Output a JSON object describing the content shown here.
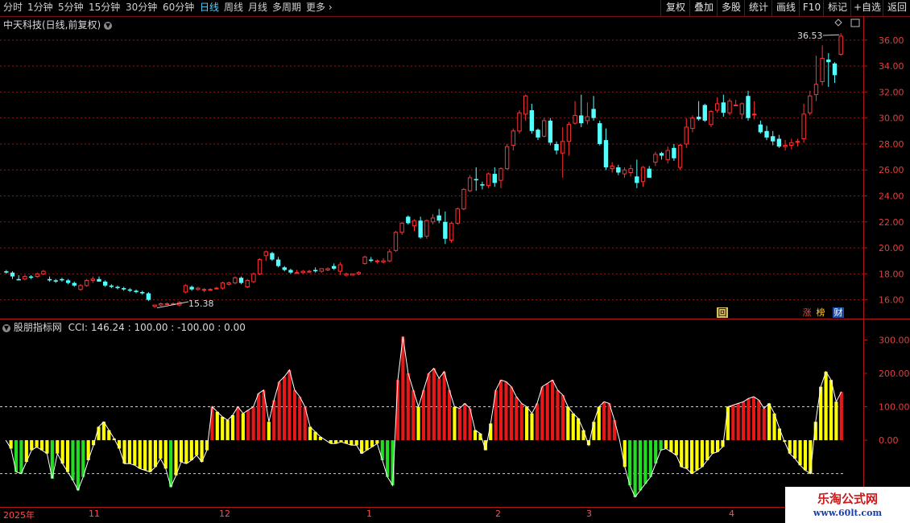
{
  "toolbar": {
    "periods": [
      "分时",
      "1分钟",
      "5分钟",
      "15分钟",
      "30分钟",
      "60分钟",
      "日线",
      "周线",
      "月线",
      "多周期",
      "更多"
    ],
    "active_period": "日线",
    "right_buttons": [
      "复权",
      "叠加",
      "多股",
      "统计",
      "画线",
      "F10",
      "标记",
      "+自选",
      "返回"
    ]
  },
  "price_panel": {
    "title": "中天科技(日线,前复权)",
    "high_label": "36.53",
    "low_label": "15.38",
    "badges": [
      "回",
      "涨",
      "榜",
      "财"
    ]
  },
  "indicator_panel": {
    "title": "股朋指标网",
    "cci_text": "CCI: 146.24 : 100.00 : -100.00 : 0.00"
  },
  "date_axis": [
    "2025年",
    "11",
    "12",
    "1",
    "2",
    "3",
    "4"
  ],
  "watermark": {
    "title": "乐淘公式网",
    "url": "www.60lt.com"
  },
  "colors": {
    "up": "#ff3232",
    "down": "#54ffff",
    "cci_red": "#e81818",
    "cci_yellow": "#ffff00",
    "cci_green": "#22dd22",
    "grid": "#8b1a1a"
  },
  "chart_data": [
    {
      "type": "candlestick",
      "y_ticks": [
        16,
        18,
        20,
        22,
        24,
        26,
        28,
        30,
        32,
        34,
        36
      ],
      "ylim": [
        14.8,
        37.6
      ],
      "candles": [
        [
          18.2,
          18.3,
          18.0,
          18.1
        ],
        [
          18.1,
          18.2,
          17.6,
          17.8
        ],
        [
          17.6,
          17.9,
          17.5,
          17.5
        ],
        [
          17.6,
          17.9,
          17.5,
          17.8
        ],
        [
          17.8,
          17.9,
          17.6,
          17.7
        ],
        [
          17.8,
          18.1,
          17.7,
          18.0
        ],
        [
          18.0,
          18.3,
          17.9,
          18.2
        ],
        [
          17.6,
          17.8,
          17.4,
          17.5
        ],
        [
          17.5,
          17.6,
          17.3,
          17.4
        ],
        [
          17.6,
          17.7,
          17.4,
          17.5
        ],
        [
          17.5,
          17.6,
          17.2,
          17.3
        ],
        [
          17.3,
          17.4,
          17.0,
          17.1
        ],
        [
          16.8,
          17.2,
          16.7,
          17.1
        ],
        [
          17.1,
          17.6,
          17.0,
          17.5
        ],
        [
          17.5,
          17.8,
          17.3,
          17.6
        ],
        [
          17.6,
          17.8,
          17.4,
          17.4
        ],
        [
          17.4,
          17.5,
          17.0,
          17.1
        ],
        [
          17.1,
          17.2,
          16.9,
          17.0
        ],
        [
          17.0,
          17.1,
          16.8,
          16.9
        ],
        [
          16.9,
          17.0,
          16.7,
          16.8
        ],
        [
          16.8,
          16.9,
          16.6,
          16.7
        ],
        [
          16.7,
          16.8,
          16.5,
          16.6
        ],
        [
          16.6,
          16.7,
          16.4,
          16.5
        ],
        [
          16.5,
          16.6,
          15.9,
          16.0
        ],
        [
          15.5,
          15.6,
          15.38,
          15.6
        ],
        [
          15.6,
          15.8,
          15.5,
          15.7
        ],
        [
          15.7,
          15.8,
          15.6,
          15.7
        ],
        [
          15.7,
          15.8,
          15.6,
          15.7
        ],
        [
          15.6,
          15.9,
          15.5,
          15.8
        ],
        [
          16.6,
          17.2,
          16.5,
          17.1
        ],
        [
          17.0,
          17.1,
          16.7,
          16.8
        ],
        [
          16.8,
          17.0,
          16.7,
          16.9
        ],
        [
          16.8,
          16.9,
          16.6,
          16.8
        ],
        [
          16.8,
          16.9,
          16.7,
          16.8
        ],
        [
          16.9,
          17.0,
          16.8,
          16.9
        ],
        [
          16.9,
          17.4,
          16.8,
          17.3
        ],
        [
          17.2,
          17.4,
          17.1,
          17.3
        ],
        [
          17.3,
          17.8,
          17.2,
          17.7
        ],
        [
          17.7,
          17.8,
          17.2,
          17.3
        ],
        [
          17.0,
          17.6,
          16.9,
          17.5
        ],
        [
          17.4,
          18.1,
          17.3,
          18.0
        ],
        [
          18.0,
          19.2,
          17.9,
          19.1
        ],
        [
          19.4,
          19.8,
          19.0,
          19.7
        ],
        [
          19.6,
          19.7,
          19.0,
          19.1
        ],
        [
          19.1,
          19.3,
          18.5,
          18.6
        ],
        [
          18.5,
          18.6,
          18.2,
          18.3
        ],
        [
          18.3,
          18.4,
          18.0,
          18.1
        ],
        [
          18.1,
          18.3,
          18.0,
          18.1
        ],
        [
          18.1,
          18.3,
          18.0,
          18.2
        ],
        [
          18.2,
          18.3,
          18.1,
          18.2
        ],
        [
          18.3,
          18.5,
          18.1,
          18.2
        ],
        [
          18.2,
          18.4,
          18.1,
          18.4
        ],
        [
          18.3,
          18.5,
          18.2,
          18.4
        ],
        [
          18.6,
          18.8,
          18.3,
          18.4
        ],
        [
          18.2,
          18.9,
          17.9,
          18.7
        ],
        [
          17.9,
          18.1,
          17.8,
          18.0
        ],
        [
          17.9,
          18.0,
          17.9,
          18.0
        ],
        [
          18.0,
          18.2,
          17.9,
          18.1
        ],
        [
          18.8,
          19.4,
          18.7,
          19.3
        ],
        [
          19.1,
          19.3,
          18.9,
          19.0
        ],
        [
          19.0,
          19.1,
          18.8,
          19.0
        ],
        [
          18.9,
          19.2,
          18.8,
          19.0
        ],
        [
          19.0,
          19.9,
          18.9,
          19.7
        ],
        [
          19.8,
          21.3,
          19.7,
          21.2
        ],
        [
          21.2,
          22.0,
          21.0,
          21.9
        ],
        [
          22.4,
          22.5,
          21.8,
          21.9
        ],
        [
          21.7,
          22.2,
          21.3,
          22.1
        ],
        [
          22.1,
          22.4,
          20.7,
          20.8
        ],
        [
          20.9,
          22.2,
          20.7,
          22.1
        ],
        [
          22.0,
          22.6,
          21.8,
          22.3
        ],
        [
          22.5,
          23.0,
          21.9,
          22.1
        ],
        [
          22.0,
          22.8,
          20.3,
          20.7
        ],
        [
          20.6,
          22.0,
          20.4,
          21.9
        ],
        [
          21.9,
          23.1,
          21.8,
          23.0
        ],
        [
          23.0,
          24.6,
          22.9,
          24.5
        ],
        [
          24.4,
          25.6,
          24.3,
          25.4
        ],
        [
          25.3,
          26.2,
          24.4,
          25.2
        ],
        [
          24.9,
          25.1,
          24.5,
          24.8
        ],
        [
          24.8,
          25.8,
          24.6,
          25.7
        ],
        [
          25.7,
          26.2,
          24.7,
          25.0
        ],
        [
          25.2,
          26.2,
          24.6,
          26.1
        ],
        [
          26.1,
          28.0,
          26.0,
          27.8
        ],
        [
          27.9,
          29.2,
          27.5,
          29.0
        ],
        [
          29.0,
          30.6,
          28.8,
          30.4
        ],
        [
          30.3,
          31.8,
          29.8,
          31.7
        ],
        [
          30.6,
          31.1,
          28.8,
          29.0
        ],
        [
          29.1,
          29.2,
          28.3,
          28.5
        ],
        [
          28.6,
          30.0,
          28.5,
          29.8
        ],
        [
          29.8,
          30.0,
          27.9,
          28.1
        ],
        [
          28.0,
          28.2,
          27.2,
          27.5
        ],
        [
          27.3,
          29.3,
          25.4,
          28.2
        ],
        [
          28.2,
          29.7,
          27.1,
          29.5
        ],
        [
          29.6,
          31.3,
          29.5,
          30.2
        ],
        [
          30.2,
          31.8,
          29.3,
          29.6
        ],
        [
          29.8,
          31.2,
          29.5,
          30.1
        ],
        [
          30.7,
          31.7,
          29.8,
          30.0
        ],
        [
          29.6,
          29.8,
          27.9,
          28.0
        ],
        [
          28.3,
          29.2,
          26.0,
          26.2
        ],
        [
          26.1,
          26.6,
          25.8,
          26.3
        ],
        [
          26.2,
          26.4,
          25.6,
          25.8
        ],
        [
          25.7,
          26.2,
          25.4,
          26.0
        ],
        [
          25.8,
          26.4,
          25.5,
          26.1
        ],
        [
          25.5,
          26.8,
          24.6,
          25.0
        ],
        [
          25.1,
          26.3,
          24.7,
          26.2
        ],
        [
          26.1,
          26.3,
          25.4,
          25.4
        ],
        [
          26.6,
          27.4,
          26.3,
          27.2
        ],
        [
          27.3,
          27.4,
          26.8,
          27.1
        ],
        [
          26.8,
          27.8,
          26.5,
          27.5
        ],
        [
          27.7,
          28.0,
          26.7,
          26.9
        ],
        [
          26.2,
          28.0,
          26.0,
          27.9
        ],
        [
          28.0,
          30.0,
          27.7,
          29.3
        ],
        [
          29.2,
          30.2,
          28.9,
          30.0
        ],
        [
          30.1,
          31.3,
          29.8,
          29.9
        ],
        [
          31.0,
          31.1,
          29.7,
          29.8
        ],
        [
          29.5,
          30.6,
          29.3,
          30.5
        ],
        [
          30.6,
          31.6,
          30.4,
          31.1
        ],
        [
          31.2,
          31.8,
          30.1,
          30.4
        ],
        [
          30.4,
          31.5,
          30.2,
          31.3
        ],
        [
          31.0,
          31.4,
          30.9,
          31.0
        ],
        [
          30.3,
          31.2,
          29.9,
          31.1
        ],
        [
          31.7,
          32.1,
          29.8,
          30.0
        ],
        [
          30.3,
          31.3,
          29.9,
          30.3
        ],
        [
          29.5,
          29.8,
          28.8,
          28.9
        ],
        [
          29.0,
          29.4,
          28.3,
          28.5
        ],
        [
          28.6,
          29.0,
          27.9,
          28.2
        ],
        [
          28.4,
          28.7,
          27.7,
          27.8
        ],
        [
          27.8,
          28.3,
          27.5,
          27.9
        ],
        [
          27.9,
          28.4,
          27.6,
          28.1
        ],
        [
          28.2,
          28.4,
          27.8,
          28.2
        ],
        [
          28.4,
          31.1,
          28.1,
          30.3
        ],
        [
          30.4,
          32.1,
          30.2,
          31.7
        ],
        [
          31.8,
          34.8,
          31.3,
          32.6
        ],
        [
          32.8,
          35.6,
          32.5,
          34.6
        ],
        [
          34.5,
          35.0,
          32.4,
          34.3
        ],
        [
          34.2,
          34.3,
          32.7,
          33.3
        ],
        [
          34.9,
          36.53,
          34.8,
          36.3
        ]
      ]
    },
    {
      "type": "bar",
      "name": "CCI",
      "y_ticks": [
        0,
        100,
        200,
        300
      ],
      "ylim": [
        -190,
        330
      ],
      "reference_lines": [
        100,
        -100
      ],
      "values": [
        0,
        -25,
        -95,
        -100,
        -65,
        -30,
        -20,
        -30,
        -40,
        -115,
        -40,
        -70,
        -95,
        -120,
        -150,
        -110,
        -60,
        -15,
        40,
        55,
        30,
        5,
        -25,
        -70,
        -70,
        -75,
        -85,
        -90,
        -95,
        -80,
        -55,
        -85,
        -140,
        -105,
        -65,
        -70,
        -60,
        -45,
        -65,
        -30,
        100,
        85,
        70,
        60,
        75,
        100,
        80,
        90,
        100,
        140,
        150,
        55,
        120,
        175,
        190,
        210,
        150,
        130,
        100,
        40,
        25,
        10,
        0,
        -10,
        -10,
        -5,
        -10,
        -15,
        -15,
        -40,
        -30,
        -20,
        -10,
        -60,
        -110,
        -135,
        180,
        310,
        200,
        150,
        100,
        150,
        200,
        215,
        185,
        205,
        150,
        100,
        95,
        110,
        95,
        30,
        20,
        -30,
        50,
        150,
        180,
        175,
        160,
        130,
        110,
        100,
        80,
        110,
        160,
        170,
        180,
        150,
        135,
        100,
        80,
        65,
        30,
        -15,
        55,
        100,
        115,
        110,
        60,
        0,
        -80,
        -135,
        -170,
        -150,
        -130,
        -110,
        -70,
        -30,
        -25,
        -35,
        -45,
        -80,
        -85,
        -100,
        -90,
        -80,
        -60,
        -40,
        -35,
        -20,
        100,
        105,
        110,
        115,
        125,
        130,
        120,
        95,
        110,
        80,
        35,
        -5,
        -40,
        -55,
        -75,
        -90,
        -100,
        55,
        160,
        205,
        180,
        115,
        145
      ],
      "colors": [
        "y",
        "y",
        "g",
        "g",
        "y",
        "y",
        "y",
        "y",
        "y",
        "g",
        "y",
        "y",
        "y",
        "g",
        "g",
        "g",
        "y",
        "y",
        "y",
        "y",
        "y",
        "y",
        "y",
        "y",
        "y",
        "y",
        "y",
        "y",
        "y",
        "y",
        "y",
        "y",
        "g",
        "y",
        "y",
        "y",
        "y",
        "y",
        "y",
        "y",
        "r",
        "y",
        "y",
        "y",
        "y",
        "r",
        "y",
        "r",
        "r",
        "r",
        "r",
        "y",
        "r",
        "r",
        "r",
        "r",
        "r",
        "r",
        "r",
        "y",
        "y",
        "y",
        "y",
        "y",
        "y",
        "y",
        "y",
        "y",
        "y",
        "y",
        "y",
        "y",
        "y",
        "g",
        "g",
        "g",
        "r",
        "r",
        "r",
        "r",
        "y",
        "r",
        "r",
        "r",
        "r",
        "r",
        "r",
        "y",
        "r",
        "r",
        "r",
        "y",
        "y",
        "y",
        "y",
        "r",
        "r",
        "r",
        "r",
        "r",
        "r",
        "y",
        "y",
        "r",
        "r",
        "r",
        "r",
        "r",
        "r",
        "y",
        "y",
        "y",
        "y",
        "y",
        "y",
        "y",
        "r",
        "r",
        "r",
        "y",
        "y",
        "g",
        "g",
        "g",
        "g",
        "g",
        "g",
        "g",
        "y",
        "y",
        "y",
        "y",
        "y",
        "y",
        "y",
        "y",
        "y",
        "y",
        "y",
        "y",
        "y",
        "r",
        "r",
        "r",
        "r",
        "r",
        "r",
        "r",
        "y",
        "y",
        "y",
        "y",
        "y",
        "y",
        "y",
        "y",
        "y",
        "y",
        "y",
        "y",
        "y",
        "y",
        "r",
        "r",
        "r",
        "r"
      ]
    }
  ]
}
